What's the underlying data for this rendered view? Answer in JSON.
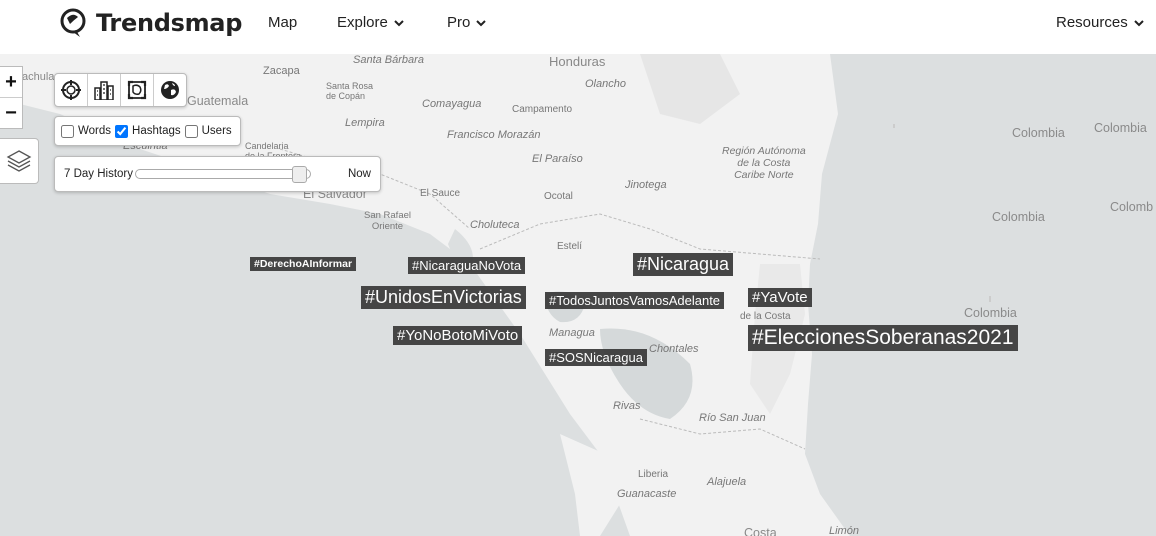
{
  "nav": {
    "brand": "Trendsmap",
    "map": "Map",
    "explore": "Explore",
    "pro": "Pro",
    "resources": "Resources"
  },
  "controls": {
    "zoom_in": "+",
    "zoom_out": "−",
    "filters": {
      "words": "Words",
      "hashtags": "Hashtags",
      "users": "Users",
      "words_checked": false,
      "hashtags_checked": true,
      "users_checked": false
    },
    "history": {
      "label": "7 Day History",
      "end": "Now",
      "position": 0.97
    }
  },
  "places": {
    "achula": "achula",
    "zacapa": "Zacapa",
    "santa_barbara": "Santa Bárbara",
    "honduras": "Honduras",
    "olancho": "Olancho",
    "guatemala": "Guatemala",
    "santa_rosa": "Santa Rosa\nde Copán",
    "comayagua": "Comayagua",
    "campamento": "Campamento",
    "lempira": "Lempira",
    "francisco": "Francisco Morazán",
    "escuintla": "Escuintla",
    "candelaria": "Candelaria\nde la Frontera",
    "el_paraiso": "El Paraíso",
    "region_autonoma": "Región Autónoma\nde la Costa\nCaribe Norte",
    "jinotega": "Jinotega",
    "el_salvador": "El Salvador",
    "el_sauce": "El Sauce",
    "ocotal": "Ocotal",
    "san_rafael": "San Rafael\nOriente",
    "choluteca": "Choluteca",
    "esteli": "Estelí",
    "managua": "Managua",
    "chontales": "Chontales",
    "de_la_costa": "de la Costa",
    "rivas": "Rivas",
    "rio_san_juan": "Río San Juan",
    "liberia": "Liberia",
    "guanacaste": "Guanacaste",
    "alajuela": "Alajuela",
    "costa": "Costa",
    "limon": "Limón",
    "colombia1": "Colombia",
    "colombia2": "Colombia",
    "colombia3": "Colombia",
    "colombia4": "Colomb",
    "colombia5": "Colombia"
  },
  "hashtags": [
    {
      "text": "#DerechoAInformar"
    },
    {
      "text": "#NicaraguaNoVota"
    },
    {
      "text": "#Nicaragua"
    },
    {
      "text": "#UnidosEnVictorias"
    },
    {
      "text": "#TodosJuntosVamosAdelante"
    },
    {
      "text": "#YaVote"
    },
    {
      "text": "#YoNoBotoMiVoto"
    },
    {
      "text": "#EleccionesSoberanas2021"
    },
    {
      "text": "#SOSNicaragua"
    }
  ],
  "colors": {
    "tag_bg": "#3d3d3d",
    "sea": "#dfe2e3",
    "land": "#f2f2f2",
    "accent": "#1a73e8"
  }
}
